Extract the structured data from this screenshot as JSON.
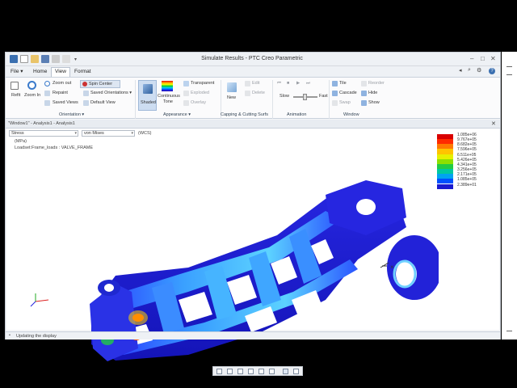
{
  "window": {
    "title": "Simulate Results - PTC Creo Parametric"
  },
  "menubar": {
    "file": "File",
    "home": "Home",
    "view": "View",
    "format": "Format"
  },
  "ribbon": {
    "refit": "Refit",
    "zoom_in": "Zoom In",
    "zoom_out": "Zoom out",
    "repaint": "Repaint",
    "saved_views": "Saved Views",
    "spin_center": "Spin Center",
    "saved_orientations": "Saved Orientations",
    "default_view": "Default View",
    "shaded": "Shaded",
    "continuous_tone_1": "Continuous",
    "continuous_tone_2": "Tone",
    "transparent": "Transparent",
    "exploded": "Exploded",
    "overlay": "Overlay",
    "new": "New",
    "edit": "Edit",
    "delete": "Delete",
    "slow": "Slow",
    "fast": "Fast",
    "tile": "Tile",
    "cascade": "Cascade",
    "swap": "Swap",
    "reorder": "Reorder",
    "hide": "Hide",
    "show": "Show",
    "groups": {
      "orientation": "Orientation",
      "appearance": "Appearance",
      "capping": "Capping & Cutting Surfs",
      "animation": "Animation",
      "window": "Window"
    }
  },
  "view_window": {
    "label": "\"Window1\" - Analysis1 - Analysis1",
    "quantity": "Stress",
    "component": "von Mises",
    "csys": "(WCS)",
    "units": "(MPa)",
    "loadset": "Loadset:Frame_loads : VALVE_FRAME"
  },
  "legend": {
    "values": [
      "1.085e+06",
      "9.767e+05",
      "8.682e+05",
      "7.596e+05",
      "6.511e+05",
      "5.426e+05",
      "4.341e+05",
      "3.256e+05",
      "2.171e+05",
      "1.085e+05",
      "2.389e+01"
    ],
    "colors": [
      "#d90000",
      "#ff2a00",
      "#ff7a00",
      "#ffc400",
      "#e6f000",
      "#8ee000",
      "#22cc44",
      "#00c8a0",
      "#00a4f0",
      "#0050ff",
      "#1a1ad0"
    ]
  },
  "status": {
    "message": "Updating the display"
  },
  "colors": {
    "accent": "#1a1ad0",
    "ribbon_bg": "#fbfbfc",
    "chrome_bg": "#eef1f5"
  }
}
